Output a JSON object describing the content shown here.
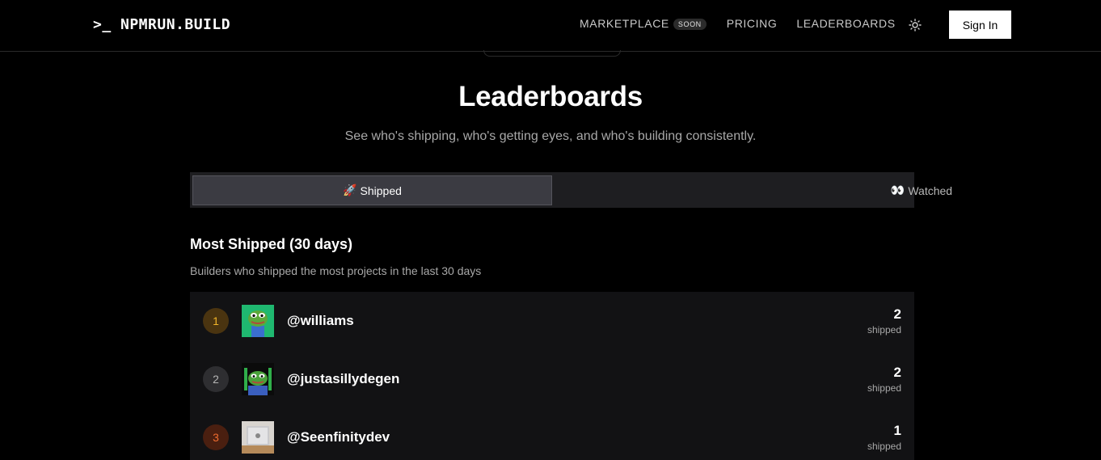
{
  "nav": {
    "logo": ">_ NPMRUN.BUILD",
    "links": [
      {
        "label": "MARKETPLACE",
        "badge": "SOON"
      },
      {
        "label": "PRICING"
      },
      {
        "label": "LEADERBOARDS"
      }
    ],
    "theme_icon": "sun-icon",
    "signin_label": "Sign In"
  },
  "header": {
    "title": "Leaderboards",
    "subtitle": "See who's shipping, who's getting eyes, and who's building consistently."
  },
  "tabs": [
    {
      "emoji": "🚀",
      "label": "Shipped",
      "active": true
    },
    {
      "emoji": "👀",
      "label": "Watched",
      "active": false
    }
  ],
  "section": {
    "title": "Most Shipped (30 days)",
    "subtitle": "Builders who shipped the most projects in the last 30 days"
  },
  "leaders": [
    {
      "rank": "1",
      "username": "@williams",
      "count": "2",
      "count_label": "shipped"
    },
    {
      "rank": "2",
      "username": "@justasillydegen",
      "count": "2",
      "count_label": "shipped"
    },
    {
      "rank": "3",
      "username": "@Seenfinitydev",
      "count": "1",
      "count_label": "shipped"
    }
  ],
  "colors": {
    "background": "#000000",
    "rank_gold": "#f0b429",
    "rank_silver": "#b5b5b5",
    "rank_bronze": "#f06c2f"
  }
}
